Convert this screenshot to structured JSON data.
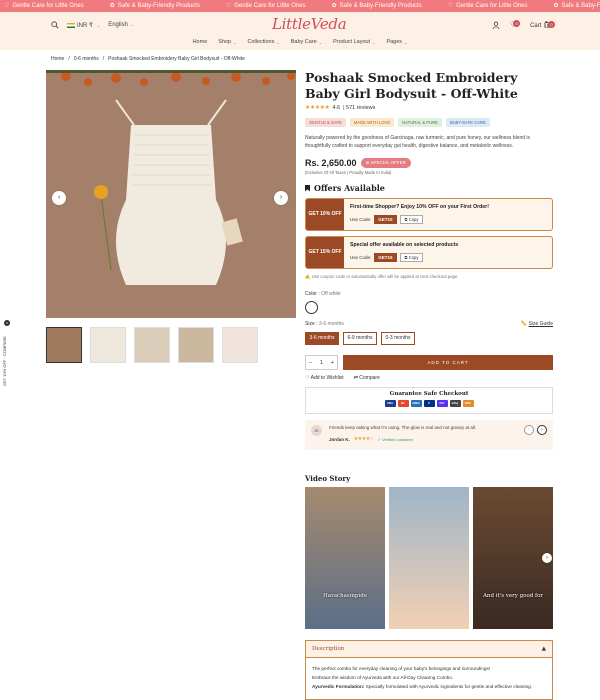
{
  "announcement": {
    "items": [
      "Gentle Care for Little Ones",
      "Safe & Baby-Friendly Products",
      "Gentle Care for Little Ones",
      "Safe & Baby-Friendly Products",
      "Gentle Care for Little Ones",
      "Safe & Baby-Friendly Products",
      "Gentle Care for Little Ones",
      "Safe & Baby-Friendly Products"
    ]
  },
  "header": {
    "currency": "INR ₹",
    "language": "English",
    "logo": "LittleVeda",
    "wishlist_count": "0",
    "cart_label": "Cart",
    "cart_count": "0",
    "nav": [
      {
        "label": "Home",
        "has_dropdown": false
      },
      {
        "label": "Shop",
        "has_dropdown": true
      },
      {
        "label": "Collections",
        "has_dropdown": true
      },
      {
        "label": "Baby Care",
        "has_dropdown": true
      },
      {
        "label": "Product Layout",
        "has_dropdown": true
      },
      {
        "label": "Pages",
        "has_dropdown": true
      }
    ]
  },
  "breadcrumb": [
    "Home",
    "/",
    "0-6 months",
    "/",
    "Poshaak Smocked Embroidery Baby Girl Bodysuit - Off-White"
  ],
  "sidebar": {
    "compare_label": "COMPARE",
    "compare_count": "0",
    "get_label": "GET 10% OFF"
  },
  "product": {
    "title": "Poshaak Smocked Embroidery Baby Girl Bodysuit - Off-White",
    "rating": "4.6",
    "reviews": "| 571 reviews",
    "tags": [
      {
        "label": "GENTLE & SAFE",
        "bg": "#f7dcdc",
        "color": "#b0505a"
      },
      {
        "label": "MADE WITH LOVE",
        "bg": "#fbe7c9",
        "color": "#a66a2a"
      },
      {
        "label": "NATURAL & PURE",
        "bg": "#dff0dc",
        "color": "#4a7a44"
      },
      {
        "label": "BABY-SAFE CARE",
        "bg": "#dde9f6",
        "color": "#40669a"
      }
    ],
    "description": "Naturally powered by the goodness of Garcinaga, raw turmeric, and pure honey, our wellness blend is thoughtfully crafted to support everyday gut health, digestive balance, and metabolic wellness.",
    "price": "Rs. 2,650.00",
    "special_badge": "SPECIAL OFFER",
    "tax_note": "(Inclusive Of All Taxes | Proudly Made In India)",
    "offers_title": "Offers Available",
    "offers": [
      {
        "badge": "GET 10% OFF",
        "text": "First-time Shopper? Enjoy 10% OFF on your First Order!",
        "use_code": "Use Code:",
        "code": "GET10",
        "copy": "Copy"
      },
      {
        "badge": "GET 15% OFF",
        "text": "Special offer available on selected products",
        "use_code": "Use Code:",
        "code": "GET15",
        "copy": "Copy"
      }
    ],
    "coupon_note": "Use coupon code or automatically offer will be applied at next checkout page",
    "color_label": "Color :",
    "color_value": "Off white",
    "size_label": "Size :",
    "size_value": "3-6 months",
    "size_guide": "Size Guide",
    "sizes": [
      "3-6 months",
      "6-9 months",
      "0-3 months"
    ],
    "selected_size": "3-6 months",
    "qty": "1",
    "add_to_cart": "ADD TO CART",
    "wishlist": "Add to Wishlist",
    "compare": "Compare",
    "checkout_title": "Guarantee Safe Checkout",
    "payment_cards": [
      {
        "name": "VISA",
        "color": "#1a3d8f"
      },
      {
        "name": "MC",
        "color": "#e8452c"
      },
      {
        "name": "AMEX",
        "color": "#2671b9"
      },
      {
        "name": "P",
        "color": "#003087"
      },
      {
        "name": "PAY",
        "color": "#5a31f4"
      },
      {
        "name": "GPay",
        "color": "#444444"
      },
      {
        "name": "DISC",
        "color": "#e58b2b"
      }
    ]
  },
  "review": {
    "initials": "JK",
    "text": "Friends keep asking what I'm using. The glow is real and not greasy at all.",
    "author": "Jordan K.",
    "stars": "★★★★☆",
    "verified": "✓ Verified customer"
  },
  "video_story": {
    "title": "Video Story",
    "captions": [
      "Harachasmpide",
      "",
      "And it's very good for"
    ]
  },
  "description_section": {
    "title": "Description",
    "line1": "The perfect combo for everyday cleaning of your baby's belongings and surroundings!",
    "line2": "Embrace the wisdom of Ayurveda with our All-Day Cleaning Combo.",
    "line3_bold": "Ayurvedic Formulation:",
    "line3": "Specially formulated with Ayurvedic ingredients for gentle and effective cleaning."
  }
}
